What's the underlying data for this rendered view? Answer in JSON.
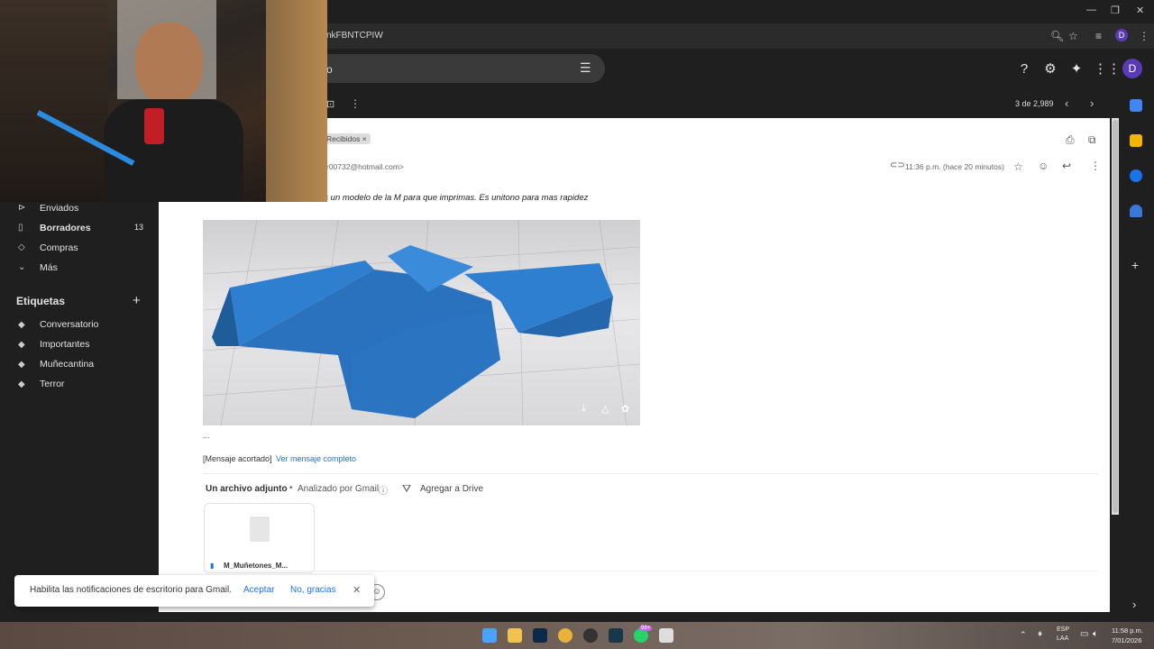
{
  "browser": {
    "url_fragment": "nkFBNTCPIW",
    "profile_initial": "D"
  },
  "gmail": {
    "search_fragment": "o",
    "avatar_initial": "D",
    "pagination": "3 de 2,989"
  },
  "sidebar": {
    "items": [
      {
        "label": "Enviados",
        "count": ""
      },
      {
        "label": "Borradores",
        "count": "13"
      },
      {
        "label": "Compras",
        "count": ""
      },
      {
        "label": "Más",
        "count": ""
      }
    ],
    "labels_heading": "Etiquetas",
    "labels": [
      "Conversatorio",
      "Importantes",
      "Muñecantina",
      "Terror"
    ]
  },
  "email": {
    "inbox_chip": "Recibidos",
    "inbox_chip_close": "×",
    "sender_fragment": "r00732@hotmail.com>",
    "timestamp": "11:36 p.m. (hace 20 minutos)",
    "body_fragment": "es un modelo de la M para que imprimas. Es unitono para mas rapidez",
    "ellipsis": "...",
    "truncated_label": "[Mensaje acortado]",
    "view_full_link": "Ver mensaje completo",
    "attachments_title": "Un archivo adjunto",
    "scanned_label": "Analizado por Gmail",
    "add_to_drive": "Agregar a Drive",
    "attachment_name": "M_Muñetones_M..."
  },
  "notification": {
    "text": "Habilita las notificaciones de escritorio para Gmail.",
    "accept": "Aceptar",
    "decline": "No, gracias"
  },
  "taskbar": {
    "lang_top": "ESP",
    "lang_bottom": "LAA",
    "time": "11:58 p.m.",
    "date": "7/01/2026",
    "whatsapp_badge": "99+"
  },
  "colors": {
    "accent_link": "#1a73e8",
    "avatar": "#5b3bb5",
    "model_blue": "#2f7fd0"
  }
}
